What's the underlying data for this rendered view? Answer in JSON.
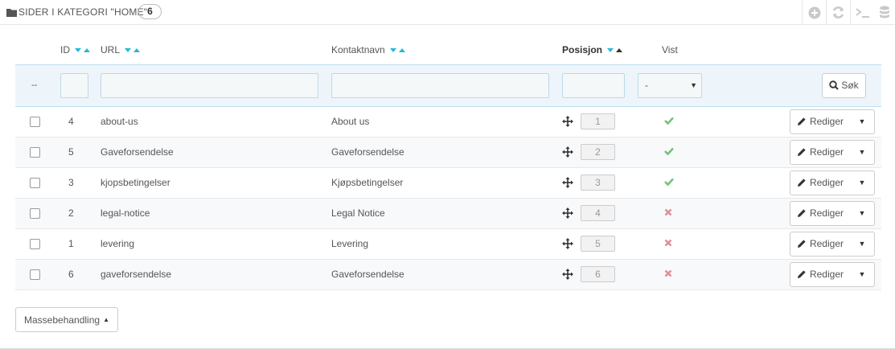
{
  "header": {
    "title": "Sider i kategori \"Home\"",
    "count": "6",
    "icons": [
      "folder-icon",
      "add-icon",
      "refresh-icon",
      "sql-query-icon",
      "database-icon"
    ]
  },
  "table": {
    "columns": {
      "id": "ID",
      "url": "URL",
      "contact": "Kontaktnavn",
      "position": "Posisjon",
      "shown": "Vist"
    },
    "filter": {
      "dash": "--",
      "id_value": "",
      "url_value": "",
      "contact_value": "",
      "position_value": "",
      "shown_selected": "-",
      "search_label": "Søk"
    },
    "rows": [
      {
        "id": "4",
        "url": "about-us",
        "name": "About us",
        "position": "1",
        "shown": true
      },
      {
        "id": "5",
        "url": "Gaveforsendelse",
        "name": "Gaveforsendelse",
        "position": "2",
        "shown": true
      },
      {
        "id": "3",
        "url": "kjopsbetingelser",
        "name": "Kjøpsbetingelser",
        "position": "3",
        "shown": true
      },
      {
        "id": "2",
        "url": "legal-notice",
        "name": "Legal Notice",
        "position": "4",
        "shown": false
      },
      {
        "id": "1",
        "url": "levering",
        "name": "Levering",
        "position": "5",
        "shown": false
      },
      {
        "id": "6",
        "url": "gaveforsendelse",
        "name": "Gaveforsendelse",
        "position": "6",
        "shown": false
      }
    ],
    "edit_label": "Rediger"
  },
  "footer": {
    "bulk_label": "Massebehandling"
  },
  "colors": {
    "accent": "#25b9d7",
    "check": "#72c279",
    "cross": "#e08f95",
    "filter_bg": "#eef5fa"
  }
}
